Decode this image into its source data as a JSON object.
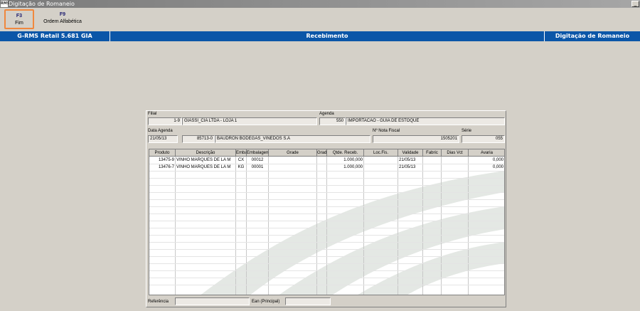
{
  "window": {
    "app_icon_text": "RMS",
    "title": "Digitação de Romaneio",
    "minimize_glyph": "_"
  },
  "toolbar": {
    "keys": [
      {
        "key": "F3",
        "label": "Fim"
      },
      {
        "key": "F9",
        "label": "Ordem Alfabética"
      }
    ]
  },
  "header_bar": {
    "left": "G-RMS Retail 5.681 GIA",
    "center": "Recebimento",
    "right": "Digitação de Romaneio"
  },
  "form": {
    "filial_label": "Filial",
    "filial_code": "1-9",
    "filial_name": "GIASSI_CIA LTDA - LOJA 1",
    "agenda_label": "Agenda",
    "agenda_code": "550",
    "agenda_desc": "IMPORTACAO - GUIA DE ESTOQUE",
    "data_agenda_label": "Data Agenda",
    "data_agenda": "21/05/13",
    "fornecedor_code": "85713-0",
    "fornecedor_name": "BAUDRON BODEGAS_VINEDOS S.A",
    "nota_label": "Nº Nota Fiscal",
    "nota_value": "1505201",
    "serie_label": "Série",
    "serie_value": "055",
    "referencia_label": "Referência",
    "referencia_value": "",
    "ean_label": "Ean (Principal)",
    "ean_value": ""
  },
  "table": {
    "columns": [
      "Produto",
      "Descrição",
      "Embalagem",
      "Embalagem",
      "Grade",
      "Grade",
      "Qtde. Receb.",
      "Loc.Fis.",
      "Validade",
      "Fabric",
      "Dias Vct",
      "Avaria"
    ],
    "rows": [
      [
        "13475-9",
        "VINHO MARQUES DE LA M",
        "CX",
        "00012",
        "",
        "",
        "1.000,000",
        "",
        "21/05/13",
        "",
        "",
        "0,000"
      ],
      [
        "13476-7",
        "VINHO MARQUES DE LA M",
        "KG",
        "00001",
        "",
        "",
        "1.000,000",
        "",
        "21/05/13",
        "",
        "",
        "0,000"
      ]
    ]
  },
  "colors": {
    "accent_blue": "#0b56a8",
    "focus_orange": "#f0883e",
    "watermark": "#e4e8e4"
  }
}
